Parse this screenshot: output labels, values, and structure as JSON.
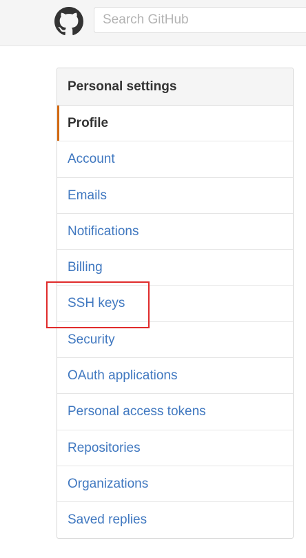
{
  "header": {
    "search_placeholder": "Search GitHub",
    "logo_icon": "github-octocat-icon"
  },
  "settings_nav": {
    "title": "Personal settings",
    "items": [
      {
        "label": "Profile",
        "selected": true
      },
      {
        "label": "Account"
      },
      {
        "label": "Emails"
      },
      {
        "label": "Notifications"
      },
      {
        "label": "Billing"
      },
      {
        "label": "SSH keys",
        "highlighted": true
      },
      {
        "label": "Security"
      },
      {
        "label": "OAuth applications"
      },
      {
        "label": "Personal access tokens"
      },
      {
        "label": "Repositories"
      },
      {
        "label": "Organizations"
      },
      {
        "label": "Saved replies"
      }
    ]
  },
  "colors": {
    "link": "#4078c0",
    "selected_accent": "#d26911",
    "highlight_border": "#e02b2b",
    "header_bg": "#f5f5f5"
  }
}
